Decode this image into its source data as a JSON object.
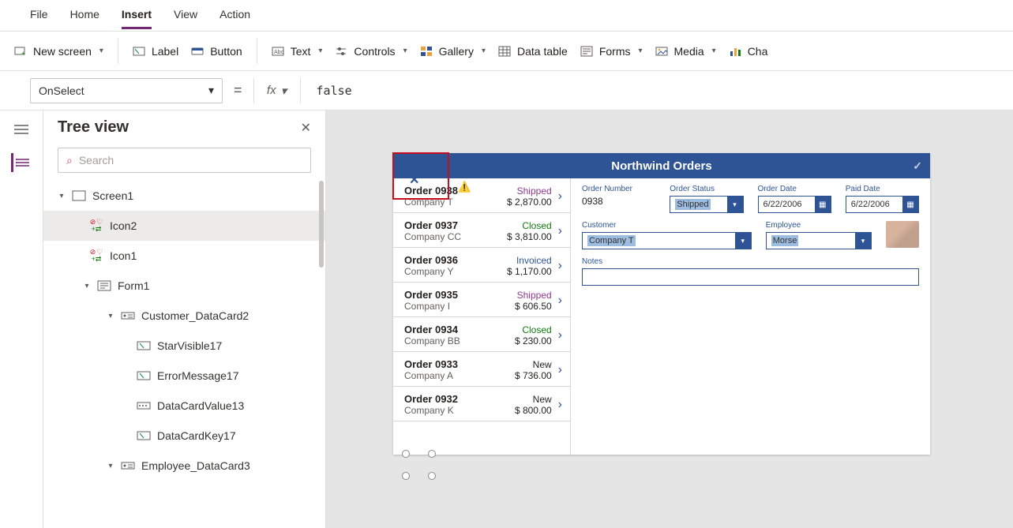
{
  "menu": {
    "file": "File",
    "home": "Home",
    "insert": "Insert",
    "view": "View",
    "action": "Action"
  },
  "ribbon": {
    "newscreen": "New screen",
    "label": "Label",
    "button": "Button",
    "text": "Text",
    "controls": "Controls",
    "gallery": "Gallery",
    "datatable": "Data table",
    "forms": "Forms",
    "media": "Media",
    "cha": "Cha"
  },
  "formula": {
    "prop": "OnSelect",
    "eq": "=",
    "fx": "fx",
    "expr": "false"
  },
  "treeview": {
    "title": "Tree view",
    "search_ph": "Search",
    "nodes": {
      "screen1": "Screen1",
      "icon2": "Icon2",
      "icon1": "Icon1",
      "form1": "Form1",
      "cust_dc": "Customer_DataCard2",
      "star": "StarVisible17",
      "err": "ErrorMessage17",
      "dcv": "DataCardValue13",
      "dck": "DataCardKey17",
      "emp_dc": "Employee_DataCard3"
    }
  },
  "app": {
    "title": "Northwind Orders",
    "form": {
      "ordernum_l": "Order Number",
      "ordernum_v": "0938",
      "status_l": "Order Status",
      "status_v": "Shipped",
      "odate_l": "Order Date",
      "odate_v": "6/22/2006",
      "pdate_l": "Paid Date",
      "pdate_v": "6/22/2006",
      "cust_l": "Customer",
      "cust_v": "Company T",
      "emp_l": "Employee",
      "emp_v": "Morse",
      "notes_l": "Notes"
    },
    "gallery": [
      {
        "ord": "Order 0938",
        "co": "Company T",
        "st": "Shipped",
        "cls": "st-shipped",
        "amt": "$ 2,870.00"
      },
      {
        "ord": "Order 0937",
        "co": "Company CC",
        "st": "Closed",
        "cls": "st-closed",
        "amt": "$ 3,810.00"
      },
      {
        "ord": "Order 0936",
        "co": "Company Y",
        "st": "Invoiced",
        "cls": "st-invoiced",
        "amt": "$ 1,170.00"
      },
      {
        "ord": "Order 0935",
        "co": "Company I",
        "st": "Shipped",
        "cls": "st-shipped",
        "amt": "$ 606.50"
      },
      {
        "ord": "Order 0934",
        "co": "Company BB",
        "st": "Closed",
        "cls": "st-closed",
        "amt": "$ 230.00"
      },
      {
        "ord": "Order 0933",
        "co": "Company A",
        "st": "New",
        "cls": "st-new",
        "amt": "$ 736.00"
      },
      {
        "ord": "Order 0932",
        "co": "Company K",
        "st": "New",
        "cls": "st-new",
        "amt": "$ 800.00"
      }
    ]
  }
}
